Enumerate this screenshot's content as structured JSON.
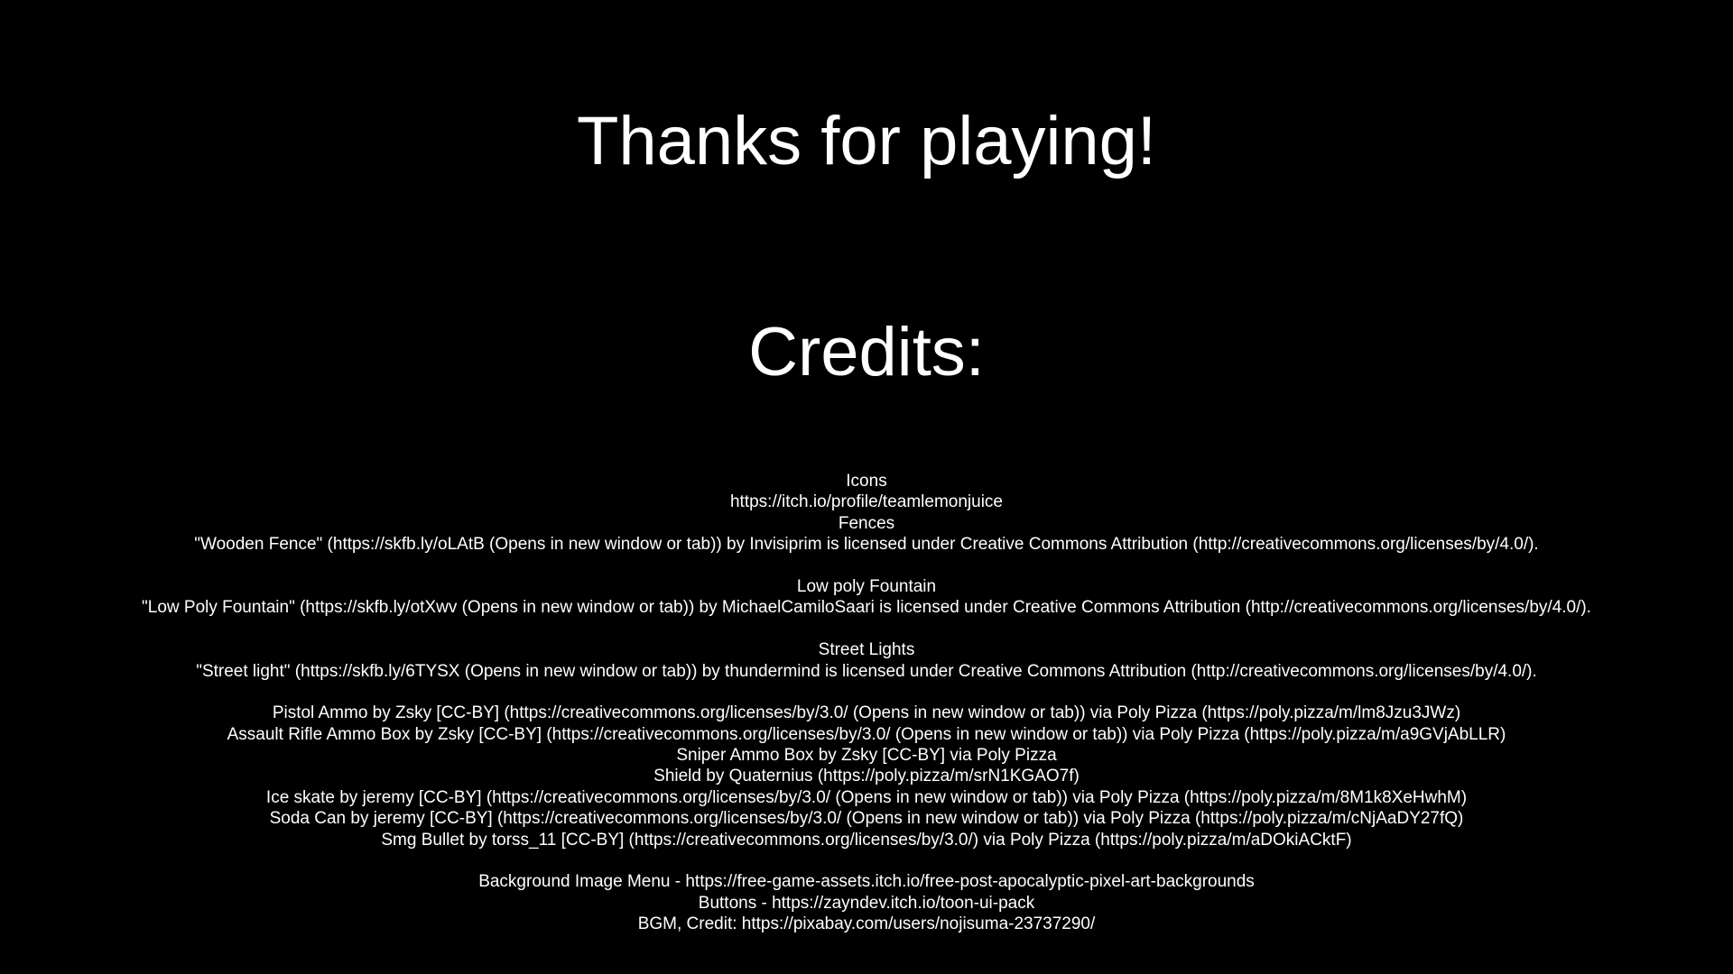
{
  "screen": {
    "title": "Thanks for playing!",
    "credits_heading": "Credits:",
    "background_color": "#000000",
    "text_color": "#ffffff"
  },
  "credits": {
    "lines": [
      "Icons",
      "https://itch.io/profile/teamlemonjuice",
      "Fences",
      "\"Wooden Fence\" (https://skfb.ly/oLAtB (Opens in new window or tab)) by Invisiprim is licensed under Creative Commons Attribution (http://creativecommons.org/licenses/by/4.0/).",
      "",
      "Low poly Fountain",
      "\"Low Poly Fountain\" (https://skfb.ly/otXwv (Opens in new window or tab)) by MichaelCamiloSaari is licensed under Creative Commons Attribution (http://creativecommons.org/licenses/by/4.0/).",
      "",
      "Street Lights",
      "\"Street light\" (https://skfb.ly/6TYSX (Opens in new window or tab)) by thundermind is licensed under Creative Commons Attribution (http://creativecommons.org/licenses/by/4.0/).",
      "",
      "Pistol Ammo by Zsky [CC-BY] (https://creativecommons.org/licenses/by/3.0/ (Opens in new window or tab)) via Poly Pizza (https://poly.pizza/m/lm8Jzu3JWz)",
      "Assault Rifle Ammo Box by Zsky [CC-BY] (https://creativecommons.org/licenses/by/3.0/ (Opens in new window or tab)) via Poly Pizza (https://poly.pizza/m/a9GVjAbLLR)",
      "Sniper Ammo Box by Zsky [CC-BY] via Poly Pizza",
      "Shield by Quaternius (https://poly.pizza/m/srN1KGAO7f)",
      "Ice skate by jeremy [CC-BY] (https://creativecommons.org/licenses/by/3.0/ (Opens in new window or tab)) via Poly Pizza (https://poly.pizza/m/8M1k8XeHwhM)",
      "Soda Can by jeremy [CC-BY] (https://creativecommons.org/licenses/by/3.0/ (Opens in new window or tab)) via Poly Pizza (https://poly.pizza/m/cNjAaDY27fQ)",
      "Smg Bullet by torss_11 [CC-BY] (https://creativecommons.org/licenses/by/3.0/) via Poly Pizza (https://poly.pizza/m/aDOkiACktF)",
      "",
      "Background Image Menu - https://free-game-assets.itch.io/free-post-apocalyptic-pixel-art-backgrounds",
      "Buttons - https://zayndev.itch.io/toon-ui-pack",
      "BGM, Credit: https://pixabay.com/users/nojisuma-23737290/"
    ]
  }
}
